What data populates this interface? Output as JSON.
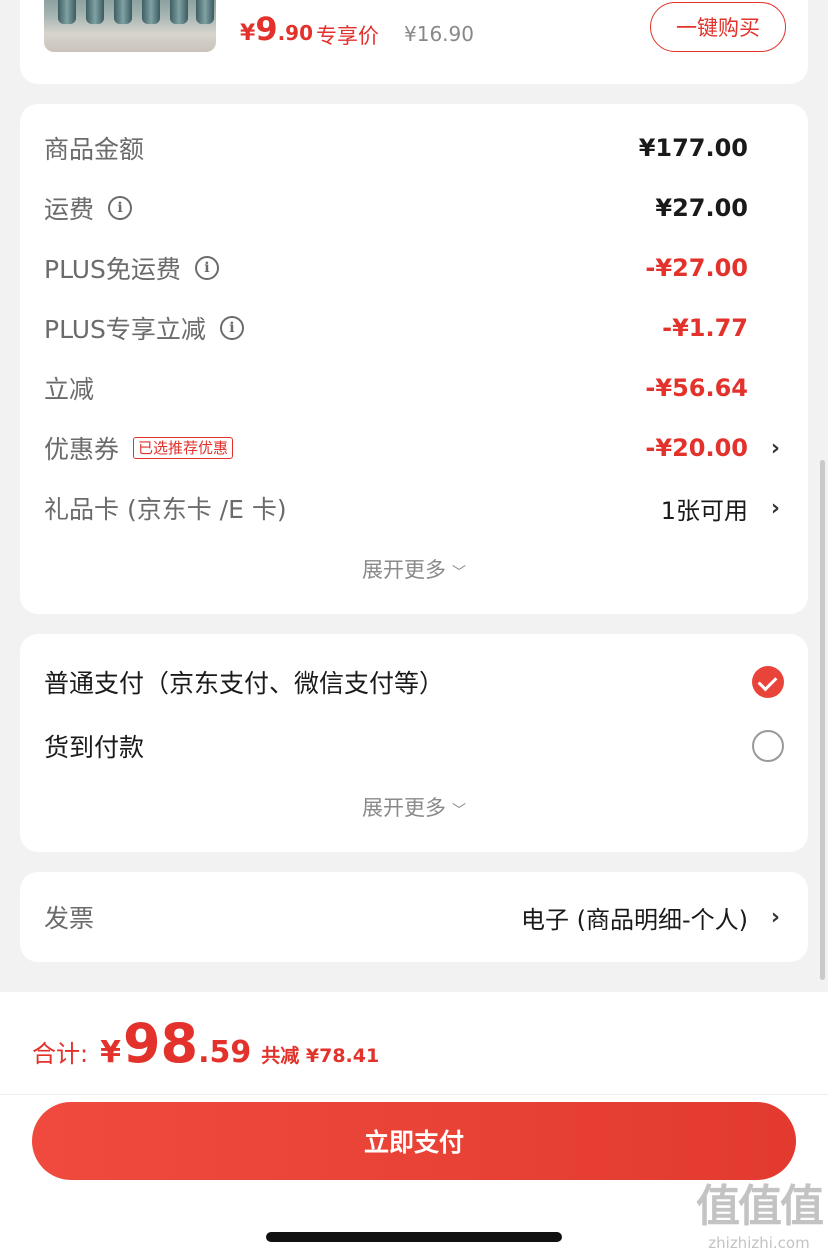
{
  "product": {
    "price_currency": "¥",
    "price_integer": "9",
    "price_decimal": ".90",
    "exclusive_label": "专享价",
    "original_price": "¥16.90",
    "buy_now_label": "一键购买"
  },
  "summary": {
    "rows": [
      {
        "label": "商品金额",
        "value": "¥177.00"
      },
      {
        "label": "运费",
        "value": "¥27.00"
      },
      {
        "label": "PLUS免运费",
        "value": "-¥27.00"
      },
      {
        "label": "PLUS专享立减",
        "value": "-¥1.77"
      },
      {
        "label": "立减",
        "value": "-¥56.64"
      },
      {
        "label": "优惠券",
        "badge": "已选推荐优惠",
        "value": "-¥20.00"
      },
      {
        "label": "礼品卡 (京东卡 /E 卡)",
        "value": "1张可用"
      }
    ],
    "expand_label": "展开更多"
  },
  "payment": {
    "options": [
      {
        "label": "普通支付（京东支付、微信支付等）",
        "selected": true
      },
      {
        "label": "货到付款",
        "selected": false
      }
    ],
    "expand_label": "展开更多"
  },
  "invoice": {
    "label": "发票",
    "value": "电子 (商品明细-个人)"
  },
  "footer": {
    "total_label": "合计:",
    "total_currency": "¥",
    "total_integer": "98",
    "total_decimal": ".59",
    "saved_text": "共减 ¥78.41",
    "pay_button_label": "立即支付"
  },
  "watermark": {
    "logo": "值值值",
    "url": "zhizhizhi.com"
  },
  "colors": {
    "accent": "#e2322b",
    "background": "#f2f2f2"
  }
}
